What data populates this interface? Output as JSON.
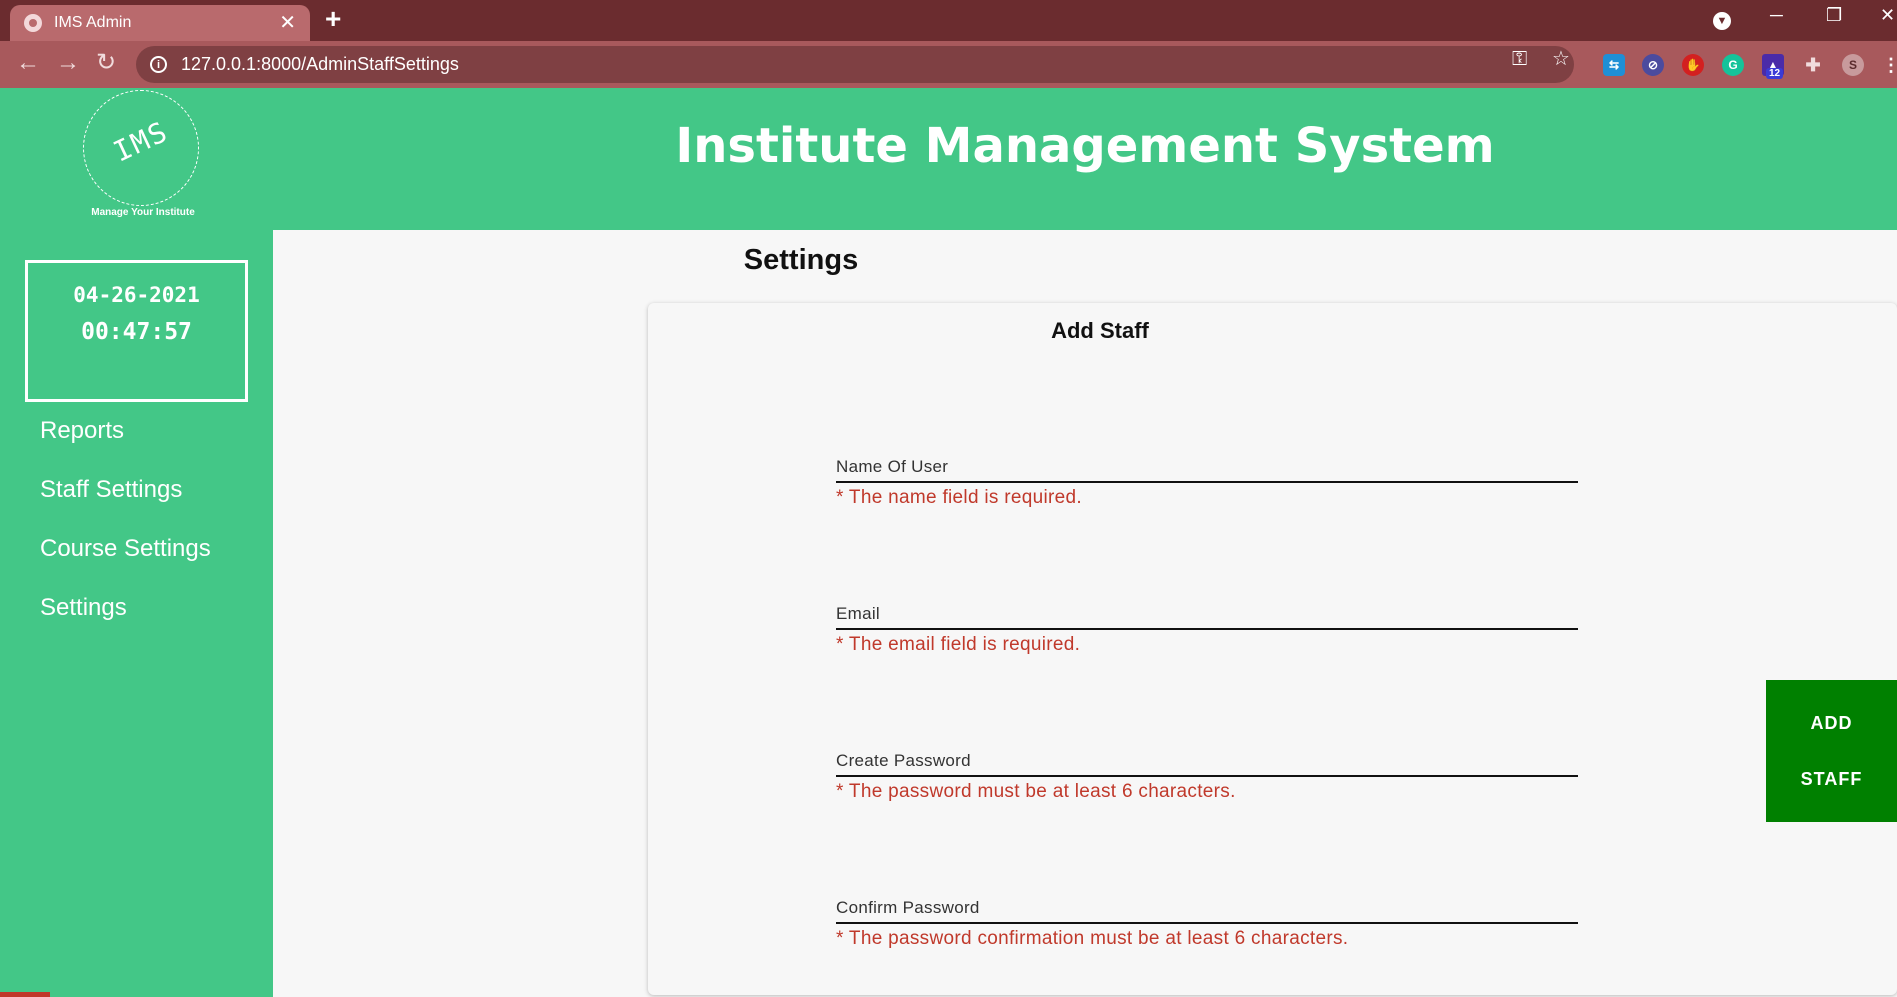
{
  "browser": {
    "tab_title": "IMS Admin",
    "tab_close": "✕",
    "new_tab": "+",
    "url": "127.0.0.1:8000/AdminStaffSettings",
    "window_controls": {
      "minimize": "─",
      "restore": "❐",
      "close": "✕"
    },
    "extension_badge": "12",
    "profile_initial": "S"
  },
  "header": {
    "logo_text": "IMS",
    "logo_tagline": "Manage Your Institute",
    "title": "Institute Management System"
  },
  "clock": {
    "date": "04-26-2021",
    "time": "00:47:57"
  },
  "sidebar": {
    "items": [
      {
        "label": "Reports"
      },
      {
        "label": "Staff Settings"
      },
      {
        "label": "Course Settings"
      },
      {
        "label": "Settings"
      }
    ]
  },
  "main": {
    "page_title": "Settings",
    "card_title": "Add Staff",
    "fields": [
      {
        "label": "Name Of User",
        "error": "* The name field is required."
      },
      {
        "label": "Email",
        "error": "* The email field is required."
      },
      {
        "label": "Create Password",
        "error": "* The password must be at least 6 characters."
      },
      {
        "label": "Confirm Password",
        "error": "* The password confirmation must be at least 6 characters."
      }
    ],
    "submit_line1": "ADD",
    "submit_line2": "STAFF"
  },
  "colors": {
    "brand_green": "#43c787",
    "button_green": "#008000",
    "error_red": "#c0392b",
    "chrome_dark": "#6b2c2f",
    "chrome_toolbar": "#a8595c"
  },
  "icons": [
    "globe-icon",
    "close-icon",
    "plus-icon",
    "back-icon",
    "forward-icon",
    "reload-icon",
    "info-icon",
    "key-icon",
    "star-icon",
    "puzzle-icon",
    "menu-icon"
  ]
}
